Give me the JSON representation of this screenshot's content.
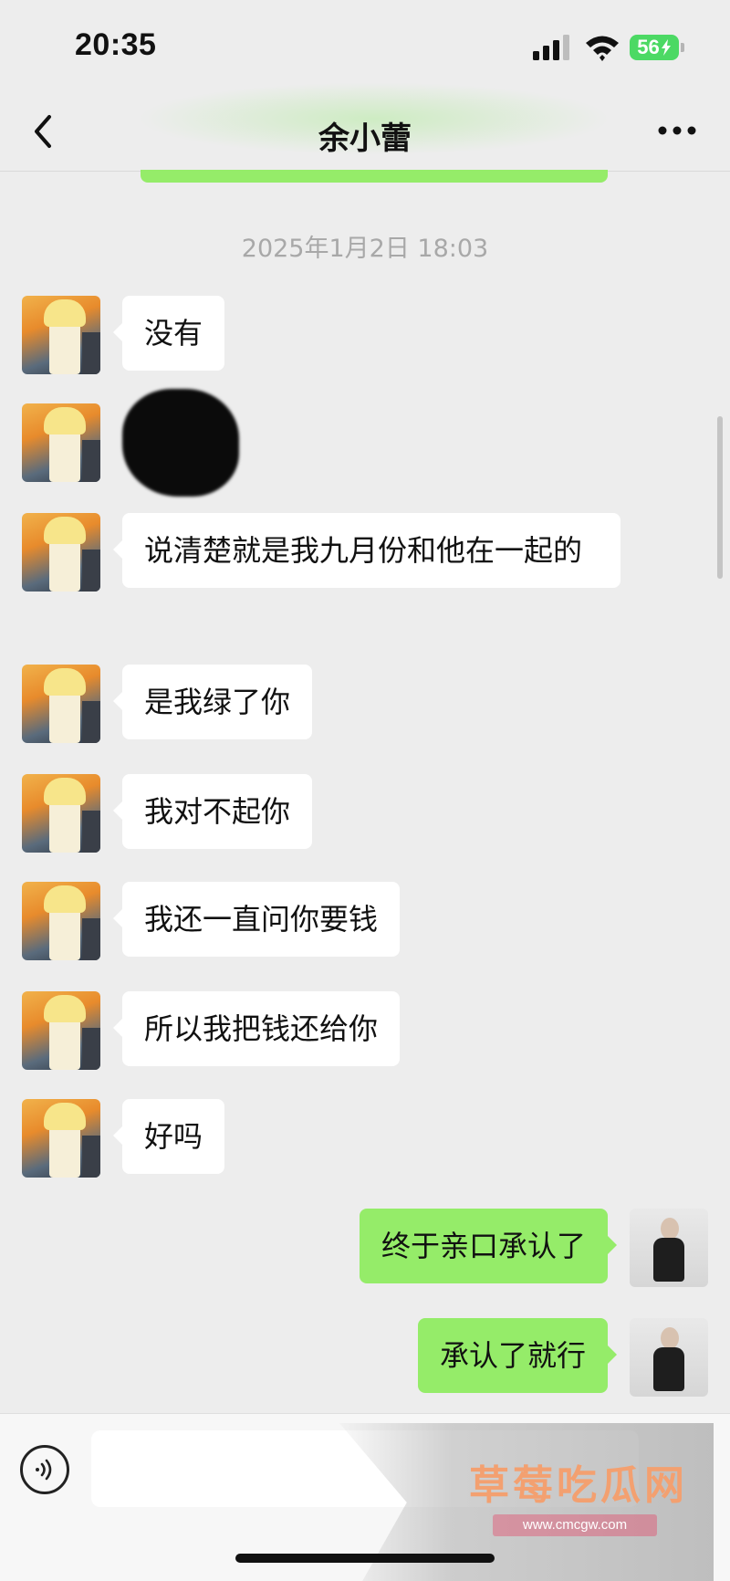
{
  "status_bar": {
    "time": "20:35",
    "battery_level": "56",
    "icons": [
      "signal-icon",
      "wifi-icon",
      "battery-charging-icon"
    ]
  },
  "nav": {
    "title": "余小蕾",
    "back_icon": "chevron-left-icon",
    "more_icon": "more-dots-icon"
  },
  "chat": {
    "timestamp": "2025年1月2日 18:03",
    "messages": [
      {
        "side": "left",
        "type": "text",
        "text": "没有"
      },
      {
        "side": "left",
        "type": "image",
        "text": ""
      },
      {
        "side": "left",
        "type": "text",
        "text": "说清楚就是我九月份和他在一起的"
      },
      {
        "side": "left",
        "type": "text",
        "text": "是我绿了你"
      },
      {
        "side": "left",
        "type": "text",
        "text": "我对不起你"
      },
      {
        "side": "left",
        "type": "text",
        "text": "我还一直问你要钱"
      },
      {
        "side": "left",
        "type": "text",
        "text": "所以我把钱还给你"
      },
      {
        "side": "left",
        "type": "text",
        "text": "好吗"
      },
      {
        "side": "right",
        "type": "text",
        "text": "终于亲口承认了"
      },
      {
        "side": "right",
        "type": "text",
        "text": "承认了就行"
      }
    ]
  },
  "input_bar": {
    "voice_icon": "voice-icon",
    "text_value": ""
  },
  "watermark": {
    "title": "草莓吃瓜网",
    "url": "www.cmcgw.com"
  },
  "colors": {
    "background": "#ededed",
    "incoming_bubble": "#ffffff",
    "outgoing_bubble": "#95ec69",
    "timestamp": "#a8a8a8",
    "battery": "#4cd964"
  }
}
